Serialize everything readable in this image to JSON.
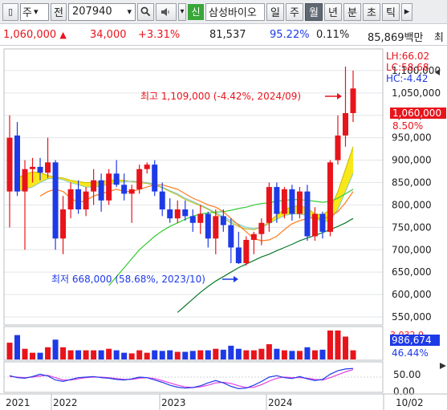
{
  "toolbar": {
    "market_label": "주",
    "jeon_label": "전",
    "code": "207940",
    "shin_label": "신",
    "stock_name": "삼성바이오",
    "periods": [
      "일",
      "주",
      "월",
      "년",
      "분",
      "초",
      "틱"
    ],
    "active_period": "월"
  },
  "quote": {
    "price": "1,060,000",
    "change_arrow": "▲",
    "change": "34,000",
    "change_pct": "+3.31%",
    "volume": "81,537",
    "volume_ratio": "95.22%",
    "turnover": "0.11%",
    "trade_value": "85,869백만",
    "trailing": "최"
  },
  "colors": {
    "up": "#e8141c",
    "down": "#1e3ae6",
    "ma_fast": "#ff7a1a",
    "ma_mid": "#33cc33",
    "ma_long": "#0a7a2a"
  },
  "legend": {
    "lh": "LH:66.02",
    "lc": "LC:58.68",
    "hc": "HC:-4.42"
  },
  "price_tag": "1,060,000",
  "price_tag_pct": "8.50%",
  "high_note": "최고 1,109,000 (-4.42%, 2024/09)",
  "low_note": "최저 668,000 (58.68%, 2023/10)",
  "volume_tag": "986,674",
  "volume_tag_top": "3,032,0",
  "stoch_tag": "46.44%",
  "chart_data": {
    "type": "candlestick",
    "y_ticks": [
      "1,100,000",
      "1,050,000",
      "1,000,000",
      "950,000",
      "900,000",
      "850,000",
      "800,000",
      "750,000",
      "700,000",
      "650,000",
      "600,000",
      "550,000"
    ],
    "y_range": [
      550000,
      1150000
    ],
    "x_labels": [
      "2021",
      "2022",
      "2023",
      "2024",
      "10/02"
    ],
    "stoch_ticks": [
      "50.00",
      "0.00"
    ],
    "candles": [
      {
        "o": 830000,
        "h": 1000000,
        "l": 750000,
        "c": 950000,
        "v": 0.55
      },
      {
        "o": 955000,
        "h": 985000,
        "l": 820000,
        "c": 830000,
        "v": 0.8
      },
      {
        "o": 830000,
        "h": 900000,
        "l": 700000,
        "c": 880000,
        "v": 0.35
      },
      {
        "o": 880000,
        "h": 905000,
        "l": 850000,
        "c": 885000,
        "v": 0.22
      },
      {
        "o": 885000,
        "h": 905000,
        "l": 855000,
        "c": 872000,
        "v": 0.22
      },
      {
        "o": 872000,
        "h": 950000,
        "l": 860000,
        "c": 895000,
        "v": 0.4
      },
      {
        "o": 895000,
        "h": 900000,
        "l": 700000,
        "c": 725000,
        "v": 0.65
      },
      {
        "o": 725000,
        "h": 820000,
        "l": 690000,
        "c": 790000,
        "v": 0.4
      },
      {
        "o": 790000,
        "h": 850000,
        "l": 770000,
        "c": 835000,
        "v": 0.3
      },
      {
        "o": 835000,
        "h": 855000,
        "l": 780000,
        "c": 790000,
        "v": 0.3
      },
      {
        "o": 790000,
        "h": 840000,
        "l": 775000,
        "c": 830000,
        "v": 0.3
      },
      {
        "o": 830000,
        "h": 880000,
        "l": 800000,
        "c": 855000,
        "v": 0.3
      },
      {
        "o": 855000,
        "h": 870000,
        "l": 785000,
        "c": 810000,
        "v": 0.3
      },
      {
        "o": 810000,
        "h": 880000,
        "l": 800000,
        "c": 870000,
        "v": 0.35
      },
      {
        "o": 870000,
        "h": 900000,
        "l": 840000,
        "c": 845000,
        "v": 0.3
      },
      {
        "o": 845000,
        "h": 870000,
        "l": 810000,
        "c": 825000,
        "v": 0.22
      },
      {
        "o": 825000,
        "h": 845000,
        "l": 760000,
        "c": 835000,
        "v": 0.2
      },
      {
        "o": 835000,
        "h": 890000,
        "l": 825000,
        "c": 880000,
        "v": 0.3
      },
      {
        "o": 880000,
        "h": 895000,
        "l": 870000,
        "c": 890000,
        "v": 0.22
      },
      {
        "o": 890000,
        "h": 900000,
        "l": 820000,
        "c": 830000,
        "v": 0.3
      },
      {
        "o": 830000,
        "h": 850000,
        "l": 775000,
        "c": 790000,
        "v": 0.28
      },
      {
        "o": 790000,
        "h": 815000,
        "l": 760000,
        "c": 770000,
        "v": 0.3
      },
      {
        "o": 770000,
        "h": 810000,
        "l": 760000,
        "c": 790000,
        "v": 0.25
      },
      {
        "o": 790000,
        "h": 810000,
        "l": 765000,
        "c": 775000,
        "v": 0.25
      },
      {
        "o": 775000,
        "h": 790000,
        "l": 740000,
        "c": 760000,
        "v": 0.28
      },
      {
        "o": 760000,
        "h": 800000,
        "l": 735000,
        "c": 780000,
        "v": 0.3
      },
      {
        "o": 780000,
        "h": 785000,
        "l": 705000,
        "c": 725000,
        "v": 0.3
      },
      {
        "o": 725000,
        "h": 790000,
        "l": 690000,
        "c": 775000,
        "v": 0.35
      },
      {
        "o": 775000,
        "h": 790000,
        "l": 740000,
        "c": 755000,
        "v": 0.32
      },
      {
        "o": 755000,
        "h": 770000,
        "l": 670000,
        "c": 705000,
        "v": 0.45
      },
      {
        "o": 705000,
        "h": 740000,
        "l": 668000,
        "c": 670000,
        "v": 0.35
      },
      {
        "o": 670000,
        "h": 730000,
        "l": 665000,
        "c": 722000,
        "v": 0.3
      },
      {
        "o": 722000,
        "h": 740000,
        "l": 690000,
        "c": 735000,
        "v": 0.3
      },
      {
        "o": 735000,
        "h": 770000,
        "l": 710000,
        "c": 760000,
        "v": 0.35
      },
      {
        "o": 760000,
        "h": 850000,
        "l": 740000,
        "c": 840000,
        "v": 0.5
      },
      {
        "o": 840000,
        "h": 850000,
        "l": 760000,
        "c": 780000,
        "v": 0.35
      },
      {
        "o": 780000,
        "h": 840000,
        "l": 770000,
        "c": 835000,
        "v": 0.3
      },
      {
        "o": 835000,
        "h": 845000,
        "l": 765000,
        "c": 780000,
        "v": 0.28
      },
      {
        "o": 780000,
        "h": 840000,
        "l": 770000,
        "c": 830000,
        "v": 0.28
      },
      {
        "o": 830000,
        "h": 845000,
        "l": 720000,
        "c": 730000,
        "v": 0.4
      },
      {
        "o": 730000,
        "h": 795000,
        "l": 720000,
        "c": 780000,
        "v": 0.3
      },
      {
        "o": 780000,
        "h": 785000,
        "l": 725000,
        "c": 740000,
        "v": 0.32
      },
      {
        "o": 740000,
        "h": 900000,
        "l": 730000,
        "c": 895000,
        "v": 0.95
      },
      {
        "o": 900000,
        "h": 1000000,
        "l": 890000,
        "c": 955000,
        "v": 0.95
      },
      {
        "o": 955000,
        "h": 1109000,
        "l": 930000,
        "c": 1005000,
        "v": 0.75
      },
      {
        "o": 1005000,
        "h": 1100000,
        "l": 985000,
        "c": 1060000,
        "v": 0.3
      }
    ],
    "ma_fast": [
      null,
      null,
      null,
      null,
      820000,
      830000,
      835000,
      830000,
      815000,
      805000,
      810000,
      820000,
      825000,
      830000,
      835000,
      830000,
      830000,
      835000,
      840000,
      845000,
      845000,
      840000,
      835000,
      825000,
      815000,
      808000,
      800000,
      795000,
      785000,
      770000,
      755000,
      740000,
      725000,
      720000,
      722000,
      730000,
      745000,
      758000,
      765000,
      770000,
      772000,
      768000,
      775000,
      785000,
      805000,
      830000
    ],
    "ma_mid": [
      null,
      null,
      null,
      null,
      null,
      null,
      null,
      null,
      null,
      null,
      null,
      null,
      null,
      620000,
      640000,
      660000,
      680000,
      700000,
      715000,
      730000,
      742000,
      752000,
      760000,
      768000,
      775000,
      780000,
      782000,
      784000,
      785000,
      788000,
      792000,
      795000,
      800000,
      803000,
      805000,
      808000,
      810000,
      812000,
      812000,
      810000,
      808000,
      806000,
      808000,
      815000,
      825000,
      835000
    ],
    "ma_long": [
      null,
      null,
      null,
      null,
      null,
      null,
      null,
      null,
      null,
      null,
      null,
      null,
      null,
      null,
      null,
      null,
      null,
      null,
      null,
      null,
      null,
      null,
      560000,
      575000,
      590000,
      605000,
      618000,
      630000,
      640000,
      650000,
      660000,
      668000,
      676000,
      684000,
      690000,
      698000,
      705000,
      712000,
      720000,
      726000,
      732000,
      738000,
      745000,
      752000,
      760000,
      770000
    ],
    "band_a": [
      null,
      860000,
      868000,
      874000,
      872000,
      866000,
      862000,
      860000,
      855000,
      852000,
      850000,
      850000,
      852000,
      855000,
      856000,
      855000,
      852000,
      850000,
      848000,
      844000,
      838000,
      830000,
      822000,
      812000,
      805000,
      798000,
      790000,
      780000,
      770000,
      760000,
      752000,
      746000,
      745000,
      750000,
      762000,
      778000,
      790000,
      796000,
      798000,
      793000,
      780000,
      778000,
      790000,
      830000,
      880000,
      930000
    ],
    "band_b": [
      null,
      830000,
      835000,
      840000,
      850000,
      858000,
      860000,
      856000,
      850000,
      845000,
      840000,
      840000,
      842000,
      846000,
      850000,
      852000,
      853000,
      852000,
      850000,
      846000,
      840000,
      832000,
      825000,
      815000,
      808000,
      800000,
      792000,
      783000,
      774000,
      765000,
      757000,
      750000,
      747000,
      750000,
      758000,
      768000,
      776000,
      780000,
      780000,
      776000,
      770000,
      762000,
      765000,
      790000,
      830000,
      870000
    ],
    "stoch_k": [
      55,
      48,
      46,
      52,
      60,
      54,
      40,
      35,
      42,
      48,
      50,
      52,
      48,
      46,
      42,
      40,
      44,
      50,
      48,
      40,
      32,
      22,
      15,
      12,
      14,
      20,
      30,
      38,
      30,
      18,
      10,
      12,
      22,
      35,
      50,
      55,
      48,
      45,
      52,
      44,
      38,
      42,
      60,
      72,
      78,
      80
    ],
    "stoch_d": [
      52,
      50,
      48,
      50,
      54,
      56,
      48,
      40,
      40,
      44,
      48,
      50,
      50,
      48,
      45,
      42,
      42,
      46,
      48,
      45,
      38,
      30,
      22,
      16,
      14,
      16,
      22,
      30,
      32,
      28,
      20,
      14,
      15,
      24,
      36,
      46,
      50,
      48,
      48,
      46,
      42,
      40,
      48,
      58,
      68,
      76
    ]
  }
}
